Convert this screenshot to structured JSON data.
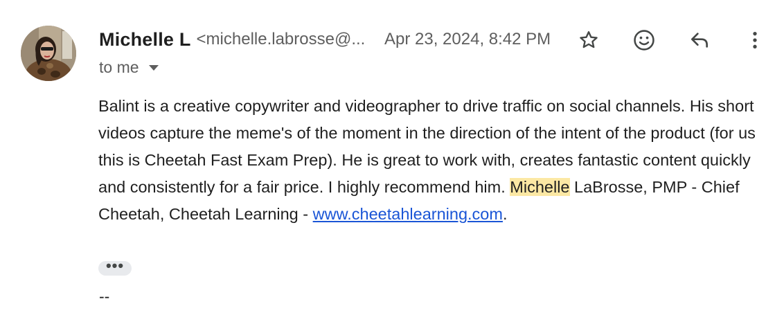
{
  "sender": {
    "name": "Michelle L",
    "email": "<michelle.labrosse@..."
  },
  "date": "Apr 23, 2024, 8:42 PM",
  "recipient": {
    "label": "to me"
  },
  "actions": {
    "star": "star-icon",
    "emoji": "emoji-icon",
    "reply": "reply-icon",
    "more": "more-vertical-icon"
  },
  "body": {
    "text_before_name": "Balint is a creative copywriter and videographer to drive traffic on social channels. His short videos capture the meme's of the moment in the direction of the intent of the product (for us this is Cheetah Fast Exam Prep).  He is great to work with, creates fantastic content quickly and consistently for a fair price.  I highly recommend him.  ",
    "highlighted_name": "Michelle",
    "text_after_name": " LaBrosse, PMP - Chief Cheetah, Cheetah Learning - ",
    "link_text": "www.cheetahlearning.com",
    "text_end": "."
  },
  "trimmed_content_label": "•••",
  "signature_separator": "--",
  "colors": {
    "highlight": "#fce8a4",
    "link": "#1a55d6",
    "secondary_text": "#5e5e5e"
  }
}
